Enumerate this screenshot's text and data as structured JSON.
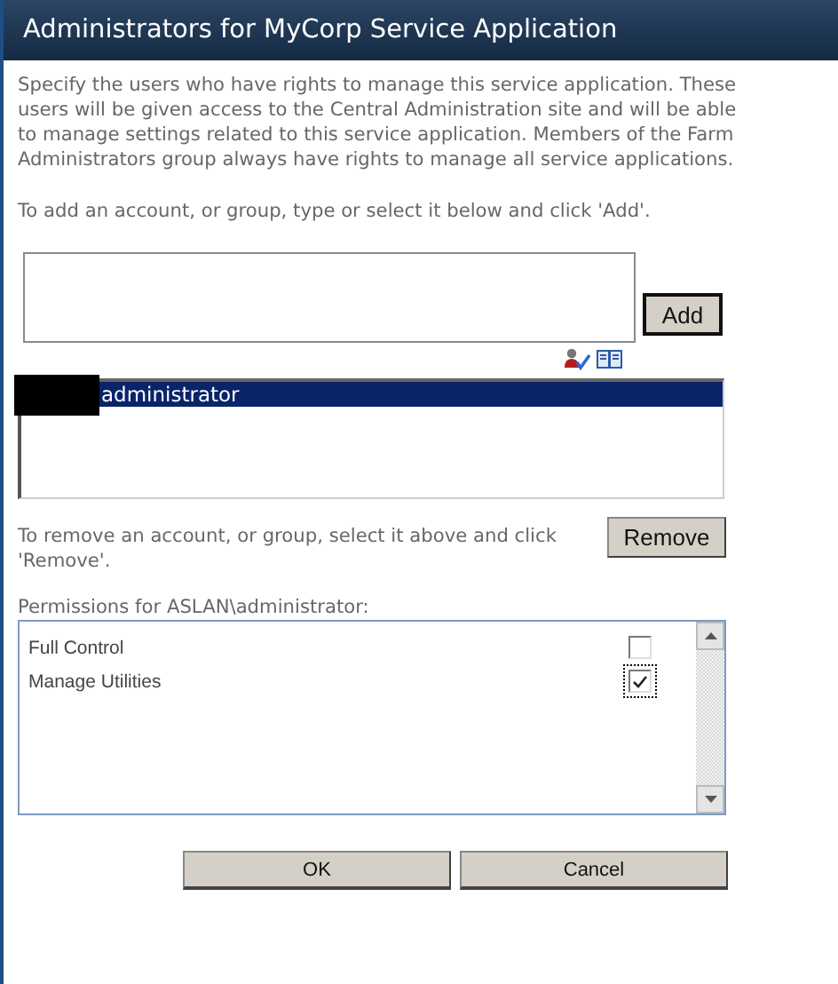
{
  "window": {
    "title": "Administrators for MyCorp Service Application"
  },
  "description": "Specify the users who have rights to manage this service application. These users will be given access to the Central Administration site and will be able to manage settings related to this service application. Members of the Farm Administrators group always have rights to manage all service applications.",
  "add_instruction": "To add an account, or group, type or select it below and click 'Add'.",
  "add_button": "Add",
  "accounts": [
    {
      "name": "administrator",
      "selected": true
    }
  ],
  "remove_instruction": "To remove an account, or group, select it above and click 'Remove'.",
  "remove_button": "Remove",
  "permissions_label": "Permissions for ASLAN\\administrator:",
  "permissions": [
    {
      "label": "Full Control",
      "checked": false
    },
    {
      "label": "Manage Utilities",
      "checked": true
    }
  ],
  "buttons": [
    "OK",
    "Cancel"
  ]
}
